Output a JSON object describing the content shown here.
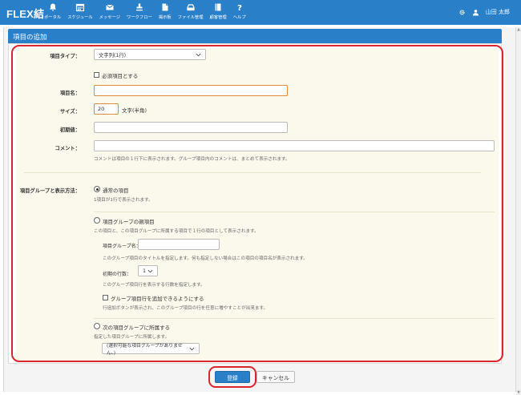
{
  "app": {
    "brand": "FLEX結"
  },
  "nav": [
    {
      "label": "ポータル",
      "icon": "bell-icon"
    },
    {
      "label": "スケジュール",
      "icon": "calendar-icon"
    },
    {
      "label": "メッセージ",
      "icon": "envelope-icon"
    },
    {
      "label": "ワークフロー",
      "icon": "stamp-icon"
    },
    {
      "label": "掲示板",
      "icon": "board-icon"
    },
    {
      "label": "ファイル管理",
      "icon": "drive-icon"
    },
    {
      "label": "顧客管理",
      "icon": "book-icon"
    },
    {
      "label": "ヘルプ",
      "icon": "question-icon"
    }
  ],
  "user": {
    "name": "山田 太郎"
  },
  "panel": {
    "title": "項目の追加"
  },
  "form": {
    "type": {
      "label": "項目タイプ：",
      "value": "文字列(1行)"
    },
    "required": {
      "label": "必須項目とする",
      "checked": false
    },
    "name": {
      "label": "項目名：",
      "value": ""
    },
    "size": {
      "label": "サイズ：",
      "value": "20",
      "unit": "文字(半角)"
    },
    "initial": {
      "label": "初期値：",
      "value": ""
    },
    "comment": {
      "label": "コメント：",
      "value": "",
      "hint": "コメントは項目の１行下に表示されます。グループ項目内のコメントは、まとめて表示されます。"
    },
    "group": {
      "label": "項目グループと表示方法：",
      "opt1": {
        "label": "通常の項目",
        "hint": "1項目が1行で表示されます。",
        "selected": true
      },
      "opt2": {
        "label": "項目グループの親項目",
        "hint": "この項目と、この項目グループに所属する項目で１行の項目として表示されます。",
        "group_name_label": "項目グループ名：",
        "group_name_value": "",
        "group_name_hint": "このグループ項目のタイトルを指定します。何も指定しない場合はこの項目の項目名が表示されます。",
        "rows_label": "初期の行数：",
        "rows_value": "1",
        "rows_hint": "このグループ項目行を表示する行数を指定します。",
        "add_rows_label": "グループ項目行を追加できるようにする",
        "add_rows_hint": "行追加ボタンが表示され、このグループ項目の行を任意に増やすことが出来ます。",
        "selected": false
      },
      "opt3": {
        "label": "次の項目グループに所属する",
        "hint": "指定した項目グループに所属します。",
        "select_value": "(選択可能な項目グループがありません。)",
        "selected": false
      }
    }
  },
  "buttons": {
    "submit": "登録",
    "cancel": "キャンセル"
  },
  "colors": {
    "accent": "#2a7fc9",
    "highlight": "#d9262b",
    "form_bg": "#fbf9ec"
  }
}
